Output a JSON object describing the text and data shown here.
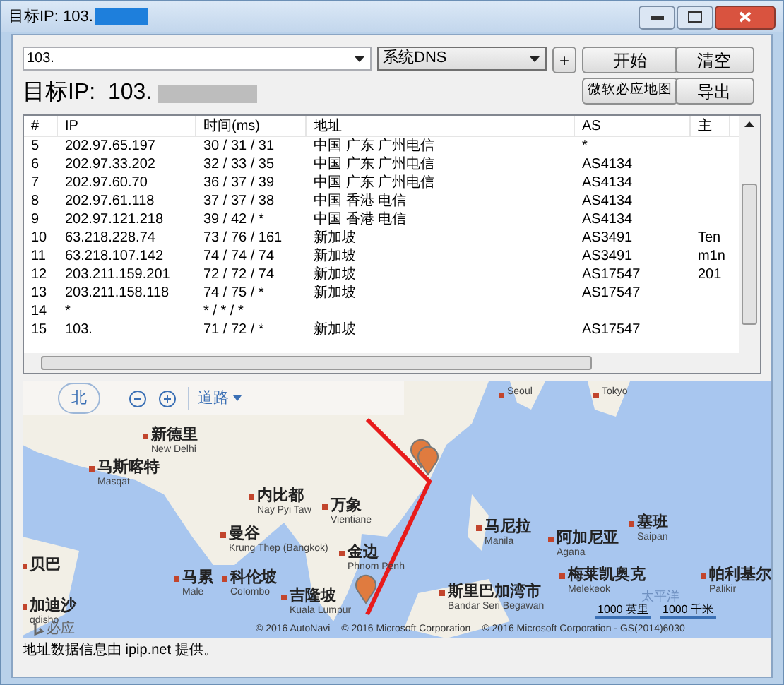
{
  "window": {
    "title": "目标IP: 103."
  },
  "toolbar": {
    "target_input": "103.",
    "dns_select": "系统DNS",
    "add_button": "+",
    "start_button": "开始",
    "clear_button": "清空",
    "map_button": "微软必应地图",
    "export_button": "导出"
  },
  "target_heading": "目标IP:  103.",
  "table": {
    "columns": [
      "#",
      "IP",
      "时间(ms)",
      "地址",
      "AS",
      "主"
    ],
    "rows": [
      [
        "5",
        "202.97.65.197",
        "30 / 31 / 31",
        "中国 广东 广州电信",
        "*",
        ""
      ],
      [
        "6",
        "202.97.33.202",
        "32 / 33 / 35",
        "中国 广东 广州电信",
        "AS4134",
        ""
      ],
      [
        "7",
        "202.97.60.70",
        "36 / 37 / 39",
        "中国 广东 广州电信",
        "AS4134",
        ""
      ],
      [
        "8",
        "202.97.61.118",
        "37 / 37 / 38",
        "中国 香港 电信",
        "AS4134",
        ""
      ],
      [
        "9",
        "202.97.121.218",
        "39 / 42 / *",
        "中国 香港 电信",
        "AS4134",
        ""
      ],
      [
        "10",
        "63.218.228.74",
        "73 / 76 / 161",
        "新加坡",
        "AS3491",
        "Ten"
      ],
      [
        "11",
        "63.218.107.142",
        "74 / 74 / 74",
        "新加坡",
        "AS3491",
        "m1n"
      ],
      [
        "12",
        "203.211.159.201",
        "72 / 72 / 74",
        "新加坡",
        "AS17547",
        "201"
      ],
      [
        "13",
        "203.211.158.118",
        "74 / 75 / *",
        "新加坡",
        "AS17547",
        ""
      ],
      [
        "14",
        "*",
        "* / * / *",
        "",
        "",
        ""
      ],
      [
        "15",
        "103.",
        "71 / 72 / *",
        "新加坡",
        "AS17547",
        ""
      ]
    ]
  },
  "map": {
    "compass": "北",
    "road_menu": "道路",
    "labels": [
      {
        "en": "Seoul"
      },
      {
        "en": "Tokyo"
      },
      {
        "zh": "新德里",
        "en": "New Delhi"
      },
      {
        "zh": "马斯喀特",
        "en": "Masqat"
      },
      {
        "zh": "内比都",
        "en": "Nay Pyi Taw"
      },
      {
        "zh": "万象",
        "en": "Vientiane"
      },
      {
        "zh": "曼谷",
        "en": "Krung Thep (Bangkok)"
      },
      {
        "zh": "金边",
        "en": "Phnom Penh"
      },
      {
        "zh": "马尼拉",
        "en": "Manila"
      },
      {
        "zh": "阿加尼亚",
        "en": "Agana"
      },
      {
        "zh": "塞班",
        "en": "Saipan"
      },
      {
        "zh": "贝巴"
      },
      {
        "zh": "马累",
        "en": "Male"
      },
      {
        "zh": "科伦坡",
        "en": "Colombo"
      },
      {
        "zh": "吉隆坡",
        "en": "Kuala Lumpur"
      },
      {
        "zh": "斯里巴加湾市",
        "en": "Bandar Seri Begawan"
      },
      {
        "zh": "梅莱凯奥克",
        "en": "Melekeok"
      },
      {
        "zh": "帕利基尔",
        "en": "Palikir"
      },
      {
        "zh": "加迪沙",
        "en": "qdisho"
      }
    ],
    "ocean_label": "太平洋",
    "bing": "必应",
    "scale": [
      "1000 英里",
      "1000 千米"
    ],
    "copyrights": [
      "© 2016 AutoNavi",
      "© 2016 Microsoft Corporation",
      "© 2016 Microsoft Corporation - GS(2014)6030"
    ]
  },
  "status_bar": "地址数据信息由 ipip.net 提供。"
}
